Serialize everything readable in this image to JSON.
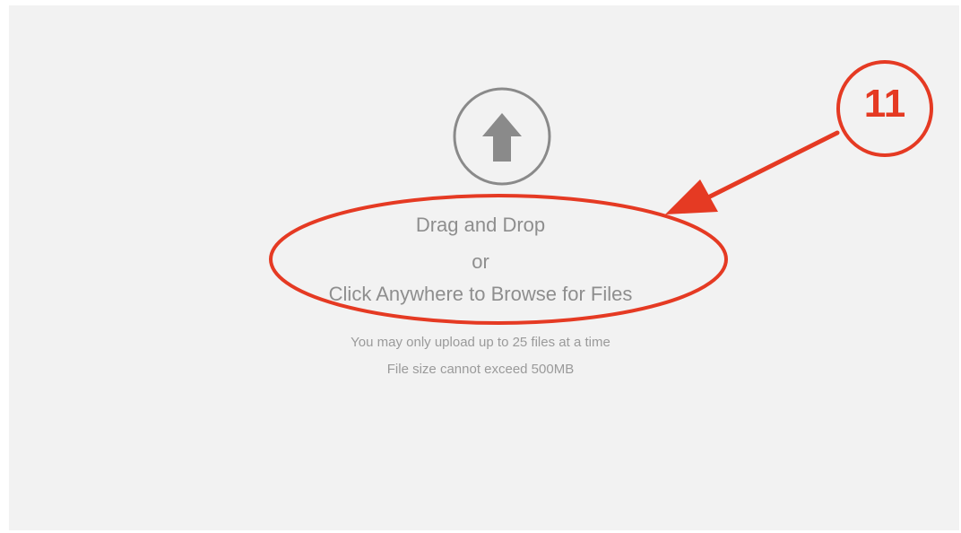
{
  "dropzone": {
    "drag_label": "Drag and Drop",
    "or_label": "or",
    "browse_label": "Click Anywhere to Browse for Files",
    "limit_label": "You may only upload up to 25 files at a time",
    "size_label": "File size cannot exceed 500MB",
    "icon": "upload-arrow-icon"
  },
  "annotation": {
    "step_number": "11",
    "color": "#e53a23"
  },
  "colors": {
    "background": "#f2f2f2",
    "text": "#8e8e8e",
    "icon": "#8a8a8a"
  }
}
